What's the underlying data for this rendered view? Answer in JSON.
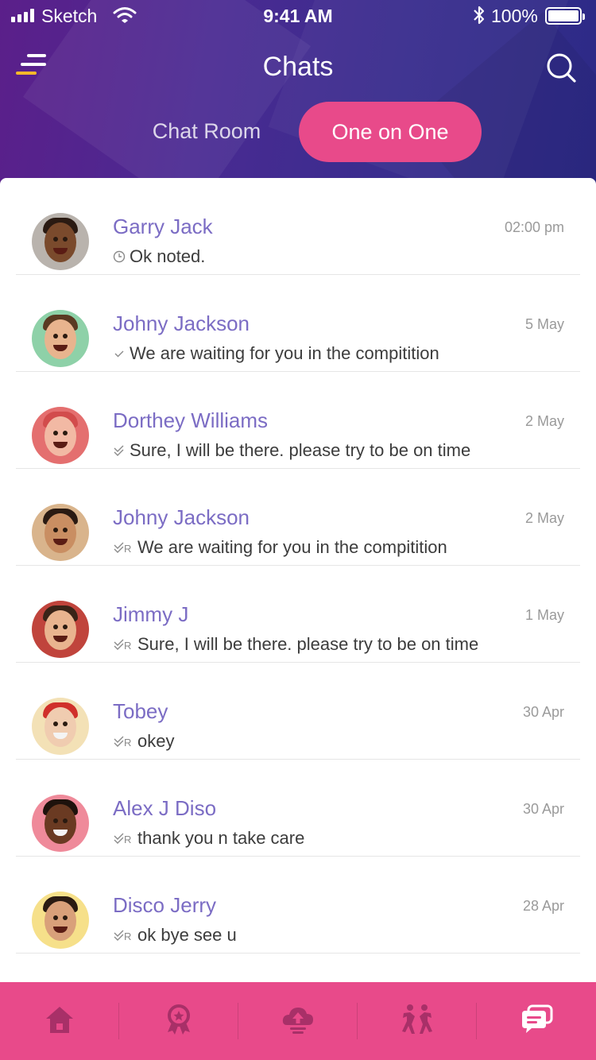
{
  "status_bar": {
    "carrier": "Sketch",
    "time": "9:41 AM",
    "battery": "100%"
  },
  "header": {
    "title": "Chats",
    "tabs": [
      {
        "label": "Chat Room",
        "active": false
      },
      {
        "label": "One on One",
        "active": true
      }
    ]
  },
  "colors": {
    "accent": "#e84a8a",
    "name_text": "#7b6cc4",
    "header_gradient_start": "#5b1f8a",
    "header_gradient_end": "#2c2a86"
  },
  "chats": [
    {
      "name": "Garry Jack",
      "time": "02:00 pm",
      "message": "Ok noted.",
      "status_icon": "clock-icon"
    },
    {
      "name": "Johny Jackson",
      "time": "5 May",
      "message": "We are waiting for you in the compitition",
      "status_icon": "check-icon"
    },
    {
      "name": "Dorthey Williams",
      "time": "2 May",
      "message": "Sure, I will be there. please try to be on time",
      "status_icon": "double-check-icon"
    },
    {
      "name": "Johny Jackson",
      "time": "2 May",
      "message": "We are waiting for you in the compitition",
      "status_icon": "double-check-read-icon"
    },
    {
      "name": "Jimmy J",
      "time": "1 May",
      "message": "Sure, I will be there. please try to be on time",
      "status_icon": "double-check-read-icon"
    },
    {
      "name": "Tobey",
      "time": "30 Apr",
      "message": "okey",
      "status_icon": "double-check-read-icon"
    },
    {
      "name": "Alex J Diso",
      "time": "30 Apr",
      "message": "thank you n take care",
      "status_icon": "double-check-read-icon"
    },
    {
      "name": "Disco Jerry",
      "time": "28 Apr",
      "message": "ok bye see u",
      "status_icon": "double-check-read-icon"
    }
  ],
  "read_marker": "R",
  "bottom_nav": [
    {
      "icon": "home-icon",
      "active": false
    },
    {
      "icon": "award-icon",
      "active": false
    },
    {
      "icon": "upload-cloud-icon",
      "active": false
    },
    {
      "icon": "dance-icon",
      "active": false
    },
    {
      "icon": "chat-icon",
      "active": true
    }
  ]
}
